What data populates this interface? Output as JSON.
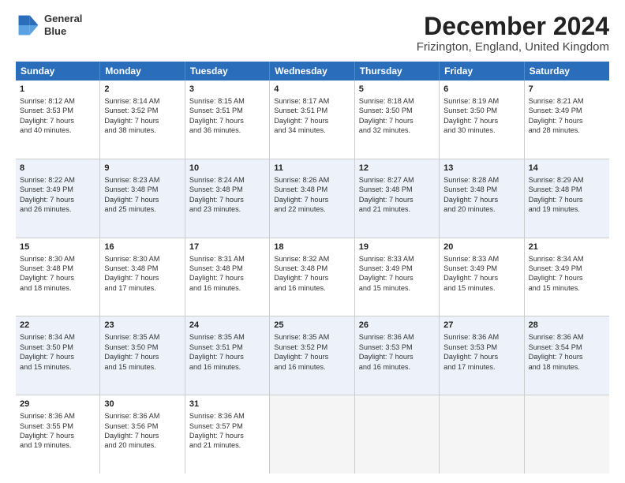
{
  "header": {
    "logo_line1": "General",
    "logo_line2": "Blue",
    "title": "December 2024",
    "subtitle": "Frizington, England, United Kingdom"
  },
  "calendar": {
    "days_of_week": [
      "Sunday",
      "Monday",
      "Tuesday",
      "Wednesday",
      "Thursday",
      "Friday",
      "Saturday"
    ],
    "weeks": [
      [
        {
          "day": "1",
          "lines": [
            "Sunrise: 8:12 AM",
            "Sunset: 3:53 PM",
            "Daylight: 7 hours",
            "and 40 minutes."
          ]
        },
        {
          "day": "2",
          "lines": [
            "Sunrise: 8:14 AM",
            "Sunset: 3:52 PM",
            "Daylight: 7 hours",
            "and 38 minutes."
          ]
        },
        {
          "day": "3",
          "lines": [
            "Sunrise: 8:15 AM",
            "Sunset: 3:51 PM",
            "Daylight: 7 hours",
            "and 36 minutes."
          ]
        },
        {
          "day": "4",
          "lines": [
            "Sunrise: 8:17 AM",
            "Sunset: 3:51 PM",
            "Daylight: 7 hours",
            "and 34 minutes."
          ]
        },
        {
          "day": "5",
          "lines": [
            "Sunrise: 8:18 AM",
            "Sunset: 3:50 PM",
            "Daylight: 7 hours",
            "and 32 minutes."
          ]
        },
        {
          "day": "6",
          "lines": [
            "Sunrise: 8:19 AM",
            "Sunset: 3:50 PM",
            "Daylight: 7 hours",
            "and 30 minutes."
          ]
        },
        {
          "day": "7",
          "lines": [
            "Sunrise: 8:21 AM",
            "Sunset: 3:49 PM",
            "Daylight: 7 hours",
            "and 28 minutes."
          ]
        }
      ],
      [
        {
          "day": "8",
          "lines": [
            "Sunrise: 8:22 AM",
            "Sunset: 3:49 PM",
            "Daylight: 7 hours",
            "and 26 minutes."
          ]
        },
        {
          "day": "9",
          "lines": [
            "Sunrise: 8:23 AM",
            "Sunset: 3:48 PM",
            "Daylight: 7 hours",
            "and 25 minutes."
          ]
        },
        {
          "day": "10",
          "lines": [
            "Sunrise: 8:24 AM",
            "Sunset: 3:48 PM",
            "Daylight: 7 hours",
            "and 23 minutes."
          ]
        },
        {
          "day": "11",
          "lines": [
            "Sunrise: 8:26 AM",
            "Sunset: 3:48 PM",
            "Daylight: 7 hours",
            "and 22 minutes."
          ]
        },
        {
          "day": "12",
          "lines": [
            "Sunrise: 8:27 AM",
            "Sunset: 3:48 PM",
            "Daylight: 7 hours",
            "and 21 minutes."
          ]
        },
        {
          "day": "13",
          "lines": [
            "Sunrise: 8:28 AM",
            "Sunset: 3:48 PM",
            "Daylight: 7 hours",
            "and 20 minutes."
          ]
        },
        {
          "day": "14",
          "lines": [
            "Sunrise: 8:29 AM",
            "Sunset: 3:48 PM",
            "Daylight: 7 hours",
            "and 19 minutes."
          ]
        }
      ],
      [
        {
          "day": "15",
          "lines": [
            "Sunrise: 8:30 AM",
            "Sunset: 3:48 PM",
            "Daylight: 7 hours",
            "and 18 minutes."
          ]
        },
        {
          "day": "16",
          "lines": [
            "Sunrise: 8:30 AM",
            "Sunset: 3:48 PM",
            "Daylight: 7 hours",
            "and 17 minutes."
          ]
        },
        {
          "day": "17",
          "lines": [
            "Sunrise: 8:31 AM",
            "Sunset: 3:48 PM",
            "Daylight: 7 hours",
            "and 16 minutes."
          ]
        },
        {
          "day": "18",
          "lines": [
            "Sunrise: 8:32 AM",
            "Sunset: 3:48 PM",
            "Daylight: 7 hours",
            "and 16 minutes."
          ]
        },
        {
          "day": "19",
          "lines": [
            "Sunrise: 8:33 AM",
            "Sunset: 3:49 PM",
            "Daylight: 7 hours",
            "and 15 minutes."
          ]
        },
        {
          "day": "20",
          "lines": [
            "Sunrise: 8:33 AM",
            "Sunset: 3:49 PM",
            "Daylight: 7 hours",
            "and 15 minutes."
          ]
        },
        {
          "day": "21",
          "lines": [
            "Sunrise: 8:34 AM",
            "Sunset: 3:49 PM",
            "Daylight: 7 hours",
            "and 15 minutes."
          ]
        }
      ],
      [
        {
          "day": "22",
          "lines": [
            "Sunrise: 8:34 AM",
            "Sunset: 3:50 PM",
            "Daylight: 7 hours",
            "and 15 minutes."
          ]
        },
        {
          "day": "23",
          "lines": [
            "Sunrise: 8:35 AM",
            "Sunset: 3:50 PM",
            "Daylight: 7 hours",
            "and 15 minutes."
          ]
        },
        {
          "day": "24",
          "lines": [
            "Sunrise: 8:35 AM",
            "Sunset: 3:51 PM",
            "Daylight: 7 hours",
            "and 16 minutes."
          ]
        },
        {
          "day": "25",
          "lines": [
            "Sunrise: 8:35 AM",
            "Sunset: 3:52 PM",
            "Daylight: 7 hours",
            "and 16 minutes."
          ]
        },
        {
          "day": "26",
          "lines": [
            "Sunrise: 8:36 AM",
            "Sunset: 3:53 PM",
            "Daylight: 7 hours",
            "and 16 minutes."
          ]
        },
        {
          "day": "27",
          "lines": [
            "Sunrise: 8:36 AM",
            "Sunset: 3:53 PM",
            "Daylight: 7 hours",
            "and 17 minutes."
          ]
        },
        {
          "day": "28",
          "lines": [
            "Sunrise: 8:36 AM",
            "Sunset: 3:54 PM",
            "Daylight: 7 hours",
            "and 18 minutes."
          ]
        }
      ],
      [
        {
          "day": "29",
          "lines": [
            "Sunrise: 8:36 AM",
            "Sunset: 3:55 PM",
            "Daylight: 7 hours",
            "and 19 minutes."
          ]
        },
        {
          "day": "30",
          "lines": [
            "Sunrise: 8:36 AM",
            "Sunset: 3:56 PM",
            "Daylight: 7 hours",
            "and 20 minutes."
          ]
        },
        {
          "day": "31",
          "lines": [
            "Sunrise: 8:36 AM",
            "Sunset: 3:57 PM",
            "Daylight: 7 hours",
            "and 21 minutes."
          ]
        },
        {
          "day": "",
          "lines": []
        },
        {
          "day": "",
          "lines": []
        },
        {
          "day": "",
          "lines": []
        },
        {
          "day": "",
          "lines": []
        }
      ]
    ]
  }
}
